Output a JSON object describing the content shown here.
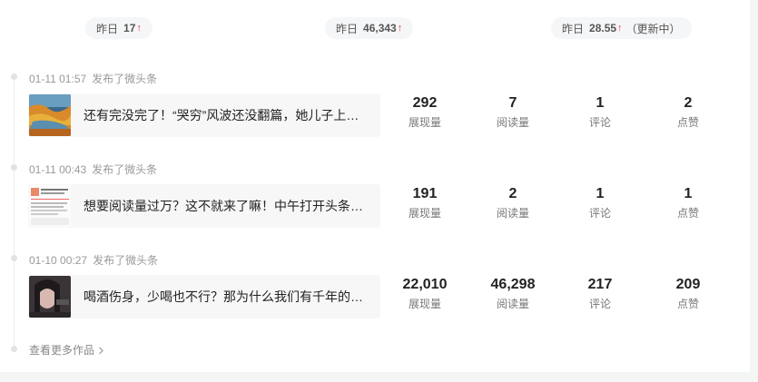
{
  "summary": {
    "impressions": {
      "label": "昨日",
      "value": "17",
      "trend": "↑"
    },
    "reads": {
      "label": "昨日",
      "value": "46,343",
      "trend": "↑"
    },
    "engagement": {
      "label": "昨日",
      "value": "28.55",
      "trend": "↑",
      "note": "（更新中）"
    }
  },
  "posts": [
    {
      "time": "01-11 01:57",
      "action": "发布了微头条",
      "title": "还有完没完了！“哭穷”风波还没翻篇，她儿子上…",
      "stats": [
        {
          "value": "292",
          "label": "展现量"
        },
        {
          "value": "7",
          "label": "阅读量"
        },
        {
          "value": "1",
          "label": "评论"
        },
        {
          "value": "2",
          "label": "点赞"
        }
      ]
    },
    {
      "time": "01-11 00:43",
      "action": "发布了微头条",
      "title": "想要阅读量过万？这不就来了嘛！中午打开头条…",
      "stats": [
        {
          "value": "191",
          "label": "展现量"
        },
        {
          "value": "2",
          "label": "阅读量"
        },
        {
          "value": "1",
          "label": "评论"
        },
        {
          "value": "1",
          "label": "点赞"
        }
      ]
    },
    {
      "time": "01-10 00:27",
      "action": "发布了微头条",
      "title": "喝酒伤身，少喝也不行？那为什么我们有千年的…",
      "stats": [
        {
          "value": "22,010",
          "label": "展现量"
        },
        {
          "value": "46,298",
          "label": "阅读量"
        },
        {
          "value": "217",
          "label": "评论"
        },
        {
          "value": "209",
          "label": "点赞"
        }
      ]
    }
  ],
  "more_link": "查看更多作品",
  "more_icon": "chevron-right-icon",
  "colors": {
    "up_arrow": "#f04142",
    "pill_bg": "#f5f6f7",
    "card_bg": "#f7f7f7"
  }
}
